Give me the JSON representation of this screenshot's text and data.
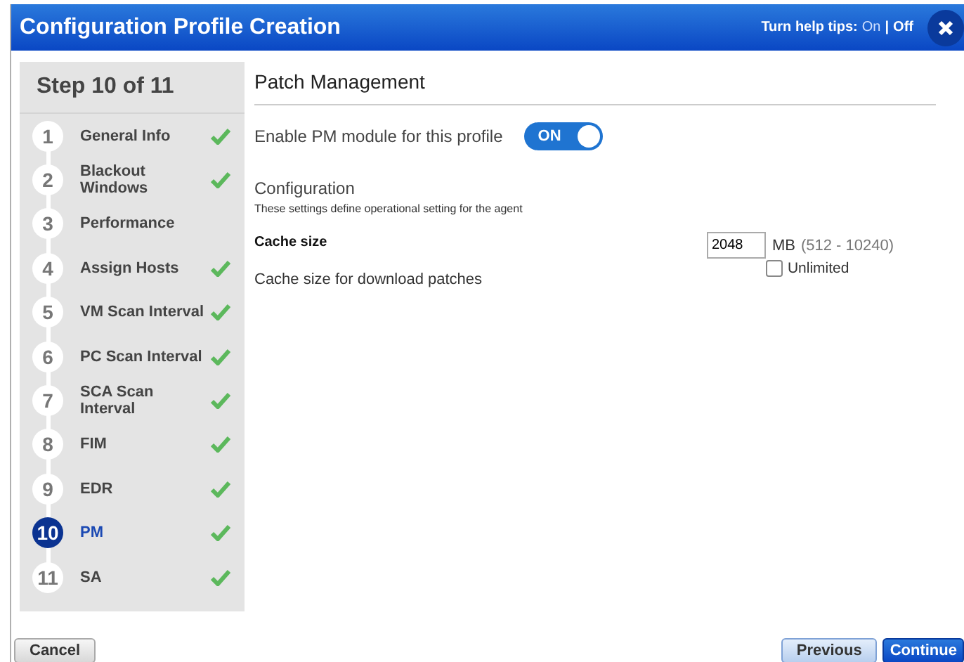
{
  "window": {
    "title": "Configuration Profile Creation",
    "help_tips": {
      "label": "Turn help tips:",
      "separator": "|",
      "options": [
        {
          "label": "On",
          "selected": false
        },
        {
          "label": "Off",
          "selected": true
        }
      ]
    }
  },
  "sidebar": {
    "title": "Step 10 of 11",
    "steps": [
      {
        "number": "1",
        "label": "General Info",
        "done": true,
        "selected": false
      },
      {
        "number": "2",
        "label": "Blackout Windows",
        "done": true,
        "selected": false
      },
      {
        "number": "3",
        "label": "Performance",
        "done": false,
        "selected": false
      },
      {
        "number": "4",
        "label": "Assign Hosts",
        "done": true,
        "selected": false
      },
      {
        "number": "5",
        "label": "VM Scan Interval",
        "done": true,
        "selected": false
      },
      {
        "number": "6",
        "label": "PC Scan Interval",
        "done": true,
        "selected": false
      },
      {
        "number": "7",
        "label": "SCA Scan Interval",
        "done": true,
        "selected": false
      },
      {
        "number": "8",
        "label": "FIM",
        "done": true,
        "selected": false
      },
      {
        "number": "9",
        "label": "EDR",
        "done": true,
        "selected": false
      },
      {
        "number": "10",
        "label": "PM",
        "done": true,
        "selected": true
      },
      {
        "number": "11",
        "label": "SA",
        "done": true,
        "selected": false
      }
    ]
  },
  "content": {
    "title": "Patch Management",
    "enable": {
      "label": "Enable PM module for this profile",
      "toggle_label": "ON",
      "on": true
    },
    "section": {
      "title": "Configuration",
      "description": "These settings define operational setting for the agent"
    },
    "cache": {
      "label": "Cache size",
      "help": "Cache size for download patches",
      "value": "2048",
      "unit": "MB",
      "range": "(512 - 10240)",
      "unlimited": {
        "label": "Unlimited",
        "checked": false
      }
    }
  },
  "footer": {
    "buttons": [
      {
        "label": "Cancel",
        "kind": "cancel"
      },
      {
        "label": "Previous",
        "kind": "secondary"
      },
      {
        "label": "Continue",
        "kind": "primary"
      }
    ]
  }
}
